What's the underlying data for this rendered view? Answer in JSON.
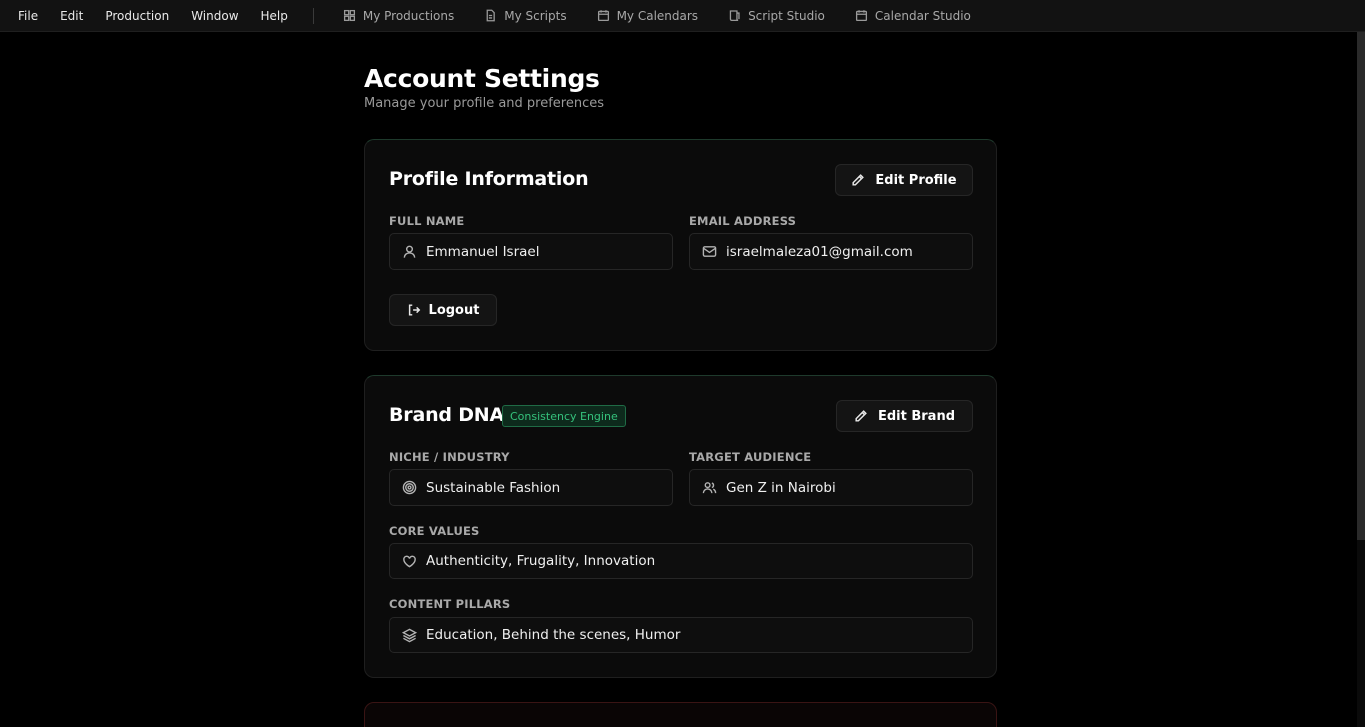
{
  "menubar": {
    "menus": [
      "File",
      "Edit",
      "Production",
      "Window",
      "Help"
    ],
    "nav": [
      {
        "label": "My Productions",
        "icon": "grid-icon"
      },
      {
        "label": "My Scripts",
        "icon": "document-icon"
      },
      {
        "label": "My Calendars",
        "icon": "calendar-icon"
      },
      {
        "label": "Script Studio",
        "icon": "script-icon"
      },
      {
        "label": "Calendar Studio",
        "icon": "calendar-icon"
      }
    ]
  },
  "page": {
    "title": "Account Settings",
    "subtitle": "Manage your profile and preferences"
  },
  "profile": {
    "title": "Profile Information",
    "edit_label": "Edit Profile",
    "full_name_label": "FULL NAME",
    "full_name": "Emmanuel Israel",
    "email_label": "EMAIL ADDRESS",
    "email": "israelmaleza01@gmail.com",
    "logout_label": "Logout"
  },
  "brand": {
    "title": "Brand DNA",
    "badge": "Consistency Engine",
    "edit_label": "Edit Brand",
    "niche_label": "NICHE / INDUSTRY",
    "niche": "Sustainable Fashion",
    "audience_label": "TARGET AUDIENCE",
    "audience": "Gen Z in Nairobi",
    "values_label": "CORE VALUES",
    "values": "Authenticity, Frugality, Innovation",
    "pillars_label": "CONTENT PILLARS",
    "pillars": "Education, Behind the scenes, Humor"
  },
  "colors": {
    "accent": "#35c27c",
    "background": "#000000",
    "card": "#0b0b0b"
  }
}
